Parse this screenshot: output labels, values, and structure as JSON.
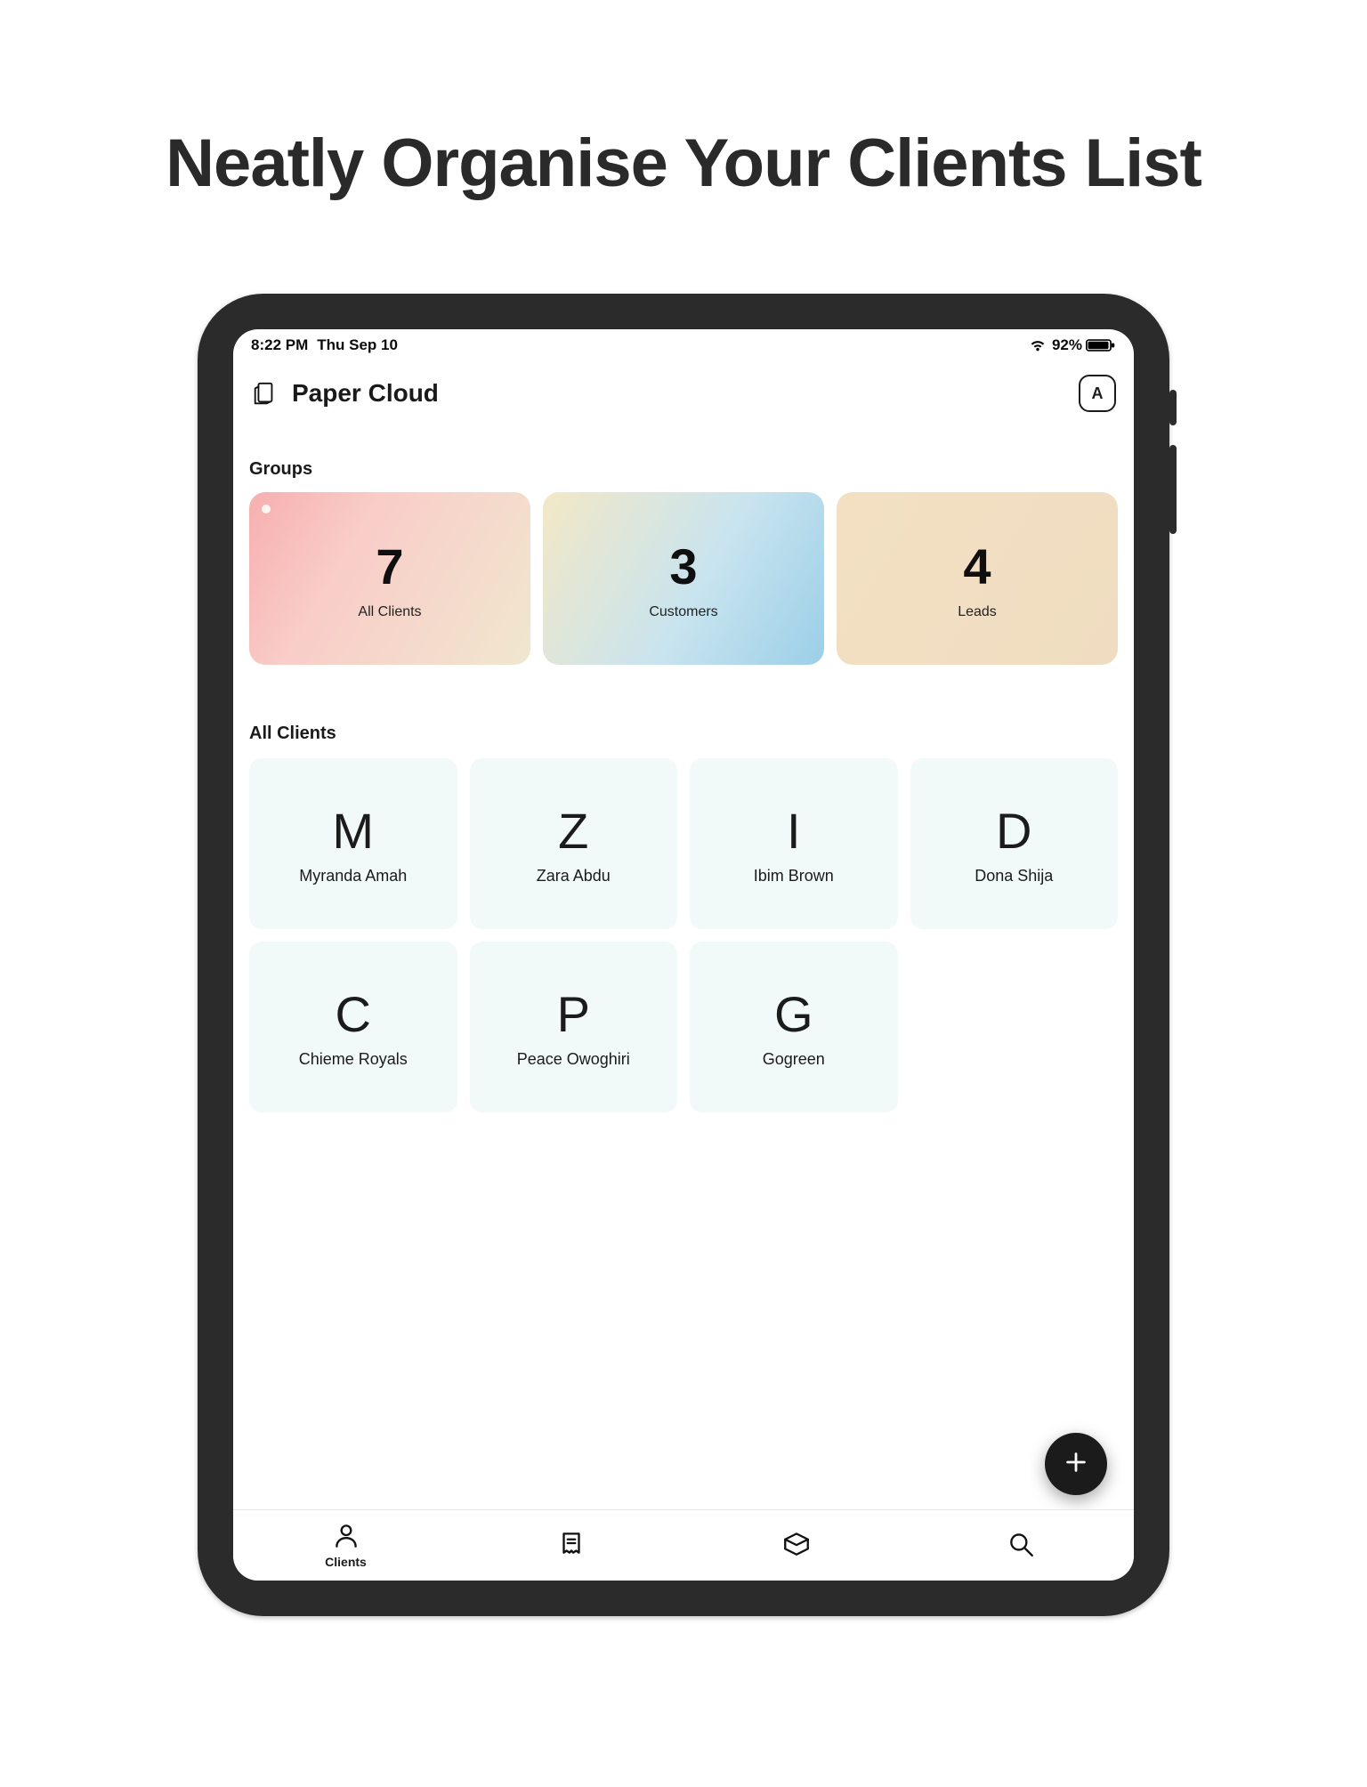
{
  "marketing": {
    "headline": "Neatly Organise Your Clients List"
  },
  "status": {
    "time": "8:22 PM",
    "date": "Thu Sep 10",
    "battery_pct": "92%"
  },
  "header": {
    "app_title": "Paper Cloud",
    "scan_label": "A"
  },
  "sections": {
    "groups_title": "Groups",
    "all_clients_title": "All Clients"
  },
  "groups": [
    {
      "count": "7",
      "label": "All Clients",
      "selected": true
    },
    {
      "count": "3",
      "label": "Customers",
      "selected": false
    },
    {
      "count": "4",
      "label": "Leads",
      "selected": false
    }
  ],
  "clients": [
    {
      "initial": "M",
      "name": "Myranda Amah"
    },
    {
      "initial": "Z",
      "name": "Zara Abdu"
    },
    {
      "initial": "I",
      "name": "Ibim Brown"
    },
    {
      "initial": "D",
      "name": "Dona Shija"
    },
    {
      "initial": "C",
      "name": "Chieme Royals"
    },
    {
      "initial": "P",
      "name": "Peace Owoghiri"
    },
    {
      "initial": "G",
      "name": "Gogreen"
    }
  ],
  "tabs": {
    "clients_label": "Clients"
  }
}
